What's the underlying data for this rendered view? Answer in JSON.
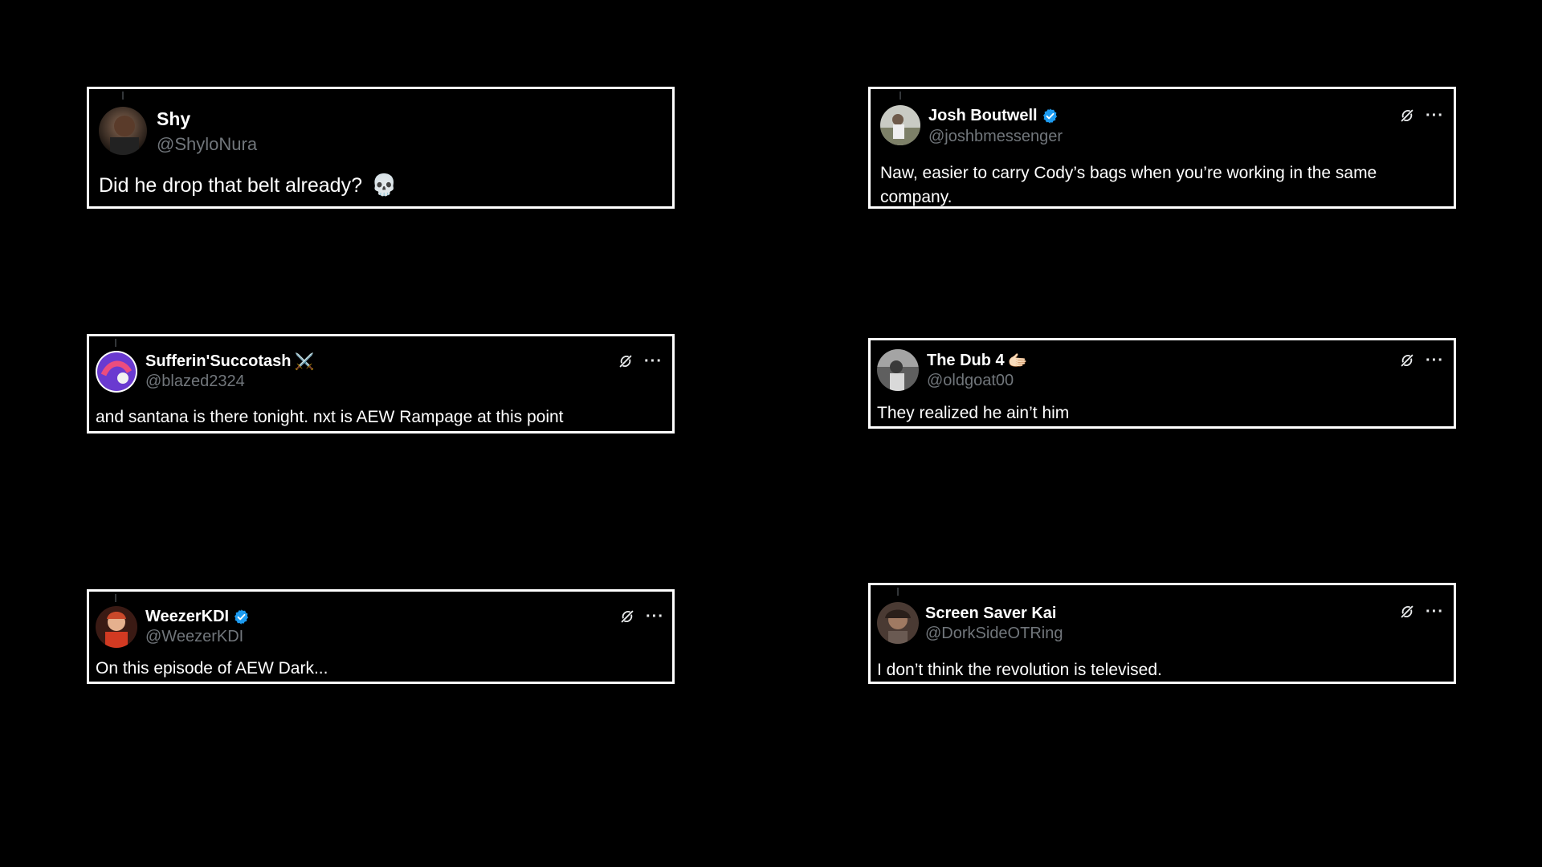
{
  "tweets": [
    {
      "display_name": "Shy",
      "handle": "@ShyloNura",
      "text": "Did he drop that belt already?",
      "verified": false,
      "text_emoji": "💀",
      "avatar_colors": [
        "#3a2a22",
        "#1a1410"
      ]
    },
    {
      "display_name": "Josh Boutwell",
      "handle": "@joshbmessenger",
      "text": "Naw, easier to carry Cody’s bags when you’re working in the same company.",
      "verified": true,
      "avatar_colors": [
        "#d9dbd6",
        "#6d705f"
      ]
    },
    {
      "display_name": "Sufferin'Succotash",
      "name_emoji": "⚔️",
      "handle": "@blazed2324",
      "text": "and santana is there tonight. nxt is AEW Rampage at this point",
      "verified": false,
      "avatar_colors": [
        "#7a3fd8",
        "#e34a7a"
      ]
    },
    {
      "display_name": "The Dub 4",
      "name_emoji": "🫱🏻",
      "handle": "@oldgoat00",
      "text": "They realized he ain’t him",
      "verified": false,
      "avatar_colors": [
        "#8d8d8d",
        "#2e2e2e"
      ]
    },
    {
      "display_name": "WeezerKDI",
      "handle": "@WeezerKDI",
      "text": "On this episode of AEW Dark...",
      "verified": true,
      "avatar_colors": [
        "#d8613e",
        "#6b1d15"
      ]
    },
    {
      "display_name": "Screen Saver Kai",
      "handle": "@DorkSideOTRing",
      "text": "I don’t think the revolution is televised.",
      "verified": false,
      "avatar_colors": [
        "#7a5a4a",
        "#2a1f1a"
      ]
    }
  ],
  "actions": {
    "more_label": "···"
  },
  "colors": {
    "background": "#000000",
    "card_border": "#ffffff",
    "handle": "#71767b",
    "verified": "#1d9bf0"
  },
  "icons": [
    "grok-icon",
    "more-icon",
    "verified-badge-icon",
    "skull-emoji",
    "swords-emoji",
    "hand-emoji"
  ]
}
